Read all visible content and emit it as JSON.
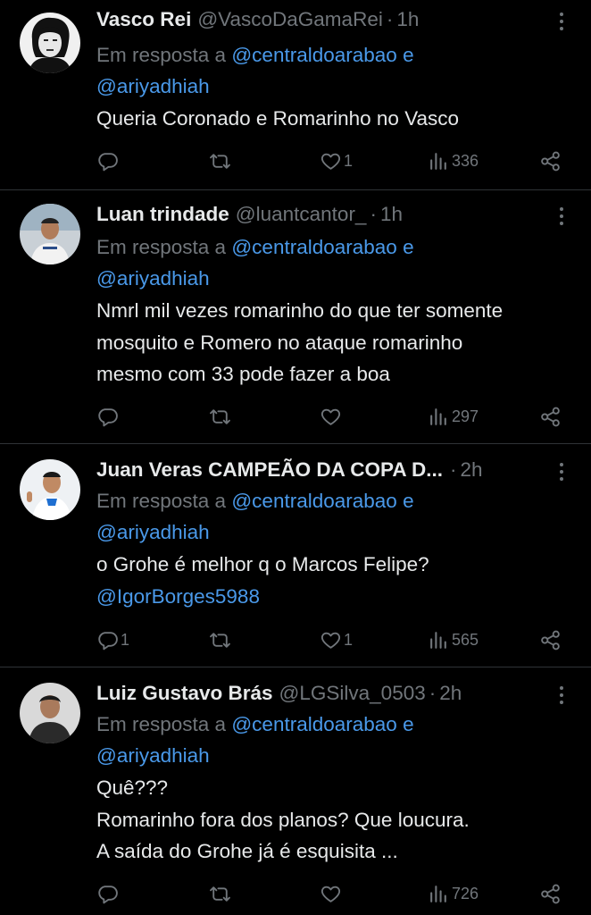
{
  "tweets": [
    {
      "name": "Vasco Rei",
      "handle": "@VascoDaGamaRei",
      "dot": "·",
      "time": "1h",
      "reply_prefix": "Em resposta a",
      "reply_user1": "@centraldoarabao",
      "reply_and": "e",
      "reply_user2": "@ariyadhiah",
      "body_lines": [
        "Queria Coronado e Romarinho no Vasco"
      ],
      "mention": "",
      "replies": "",
      "retweets": "",
      "likes": "1",
      "views": "336",
      "avatar_icon": "vasco-avatar-icon"
    },
    {
      "name": "Luan trindade",
      "handle": "@luantcantor_",
      "dot": "·",
      "time": "1h",
      "reply_prefix": "Em resposta a",
      "reply_user1": "@centraldoarabao",
      "reply_and": "e",
      "reply_user2": "@ariyadhiah",
      "body_lines": [
        "Nmrl mil vezes romarinho do que ter somente",
        "mosquito e Romero no ataque romarinho",
        "mesmo com 33 pode fazer a boa"
      ],
      "mention": "",
      "replies": "",
      "retweets": "",
      "likes": "",
      "views": "297",
      "avatar_icon": "user-avatar-icon"
    },
    {
      "name": "Juan Veras CAMPEÃO DA COPA D...",
      "handle": "",
      "dot": "·",
      "time": "2h",
      "reply_prefix": "Em resposta a",
      "reply_user1": "@centraldoarabao",
      "reply_and": "e",
      "reply_user2": "@ariyadhiah",
      "body_lines": [
        "o Grohe é melhor q o Marcos Felipe?"
      ],
      "mention": "@IgorBorges5988",
      "replies": "1",
      "retweets": "",
      "likes": "1",
      "views": "565",
      "avatar_icon": "user-avatar-icon"
    },
    {
      "name": "Luiz Gustavo Brás",
      "handle": "@LGSilva_0503",
      "dot": "·",
      "time": "2h",
      "reply_prefix": "Em resposta a",
      "reply_user1": "@centraldoarabao",
      "reply_and": "e",
      "reply_user2": "@ariyadhiah",
      "body_lines": [
        "Quê???",
        "Romarinho fora dos planos? Que loucura.",
        "A saída do Grohe já é esquisita ..."
      ],
      "mention": "",
      "replies": "",
      "retweets": "",
      "likes": "",
      "views": "726",
      "avatar_icon": "user-avatar-icon"
    }
  ],
  "icons": {
    "reply": "reply-icon",
    "retweet": "retweet-icon",
    "like": "heart-icon",
    "views": "views-icon",
    "share": "share-icon",
    "more": "more-icon"
  },
  "colors": {
    "background": "#000000",
    "text": "#e7e9ea",
    "muted": "#71767b",
    "link": "#4a99e9",
    "divider": "#2f3336"
  }
}
